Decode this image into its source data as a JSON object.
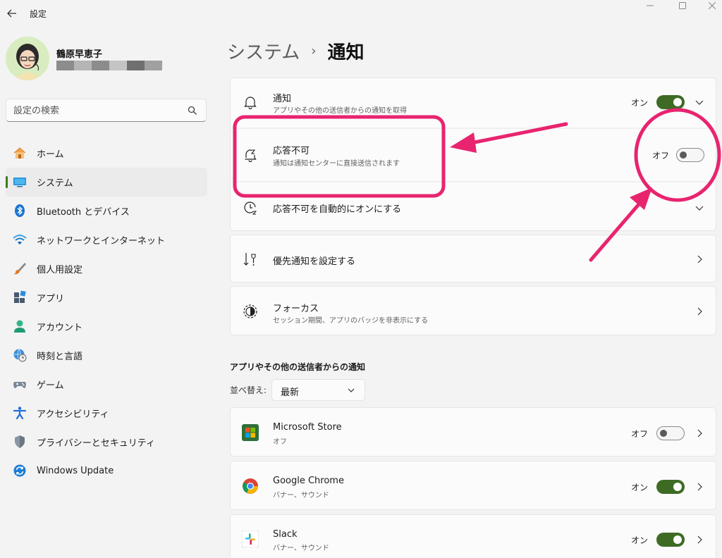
{
  "window": {
    "title": "設定",
    "back_icon": "back-arrow-icon"
  },
  "user": {
    "name": "鶴原早恵子"
  },
  "search": {
    "placeholder": "設定の検索"
  },
  "nav": [
    {
      "label": "ホーム",
      "icon": "home-icon",
      "active": false
    },
    {
      "label": "システム",
      "icon": "system-icon",
      "active": true
    },
    {
      "label": "Bluetooth とデバイス",
      "icon": "bluetooth-icon",
      "active": false
    },
    {
      "label": "ネットワークとインターネット",
      "icon": "wifi-icon",
      "active": false
    },
    {
      "label": "個人用設定",
      "icon": "brush-icon",
      "active": false
    },
    {
      "label": "アプリ",
      "icon": "apps-icon",
      "active": false
    },
    {
      "label": "アカウント",
      "icon": "person-icon",
      "active": false
    },
    {
      "label": "時刻と言語",
      "icon": "globe-clock-icon",
      "active": false
    },
    {
      "label": "ゲーム",
      "icon": "gamepad-icon",
      "active": false
    },
    {
      "label": "アクセシビリティ",
      "icon": "accessibility-icon",
      "active": false
    },
    {
      "label": "プライバシーとセキュリティ",
      "icon": "shield-icon",
      "active": false
    },
    {
      "label": "Windows Update",
      "icon": "update-icon",
      "active": false
    }
  ],
  "breadcrumb": {
    "parent": "システム",
    "separator": "›",
    "current": "通知"
  },
  "settings": {
    "notifications": {
      "title": "通知",
      "subtitle": "アプリやその他の送信者からの通知を取得",
      "state": "オン",
      "on": true
    },
    "dnd": {
      "title": "応答不可",
      "subtitle": "通知は通知センターに直接送信されます",
      "state": "オフ",
      "on": false
    },
    "auto_dnd": {
      "title": "応答不可を自動的にオンにする"
    },
    "priority": {
      "title": "優先通知を設定する"
    },
    "focus": {
      "title": "フォーカス",
      "subtitle": "セッション期間、アプリのバッジを非表示にする"
    }
  },
  "apps_section": {
    "title": "アプリやその他の送信者からの通知",
    "sort_label": "並べ替え:",
    "sort_value": "最新",
    "apps": [
      {
        "name": "Microsoft Store",
        "detail": "オフ",
        "state": "オフ",
        "on": false
      },
      {
        "name": "Google Chrome",
        "detail": "バナー、サウンド",
        "state": "オン",
        "on": true
      },
      {
        "name": "Slack",
        "detail": "バナー、サウンド",
        "state": "オン",
        "on": true
      }
    ]
  },
  "colors": {
    "accent": "#3e6b24",
    "annotation": "#e8246f"
  }
}
